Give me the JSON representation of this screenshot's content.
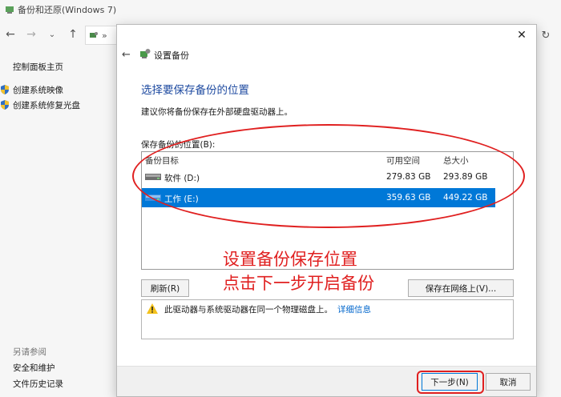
{
  "window": {
    "title": "备份和还原(Windows 7)"
  },
  "sidebar": {
    "home_link": "控制面板主页",
    "tasks": [
      {
        "label": "创建系统映像",
        "icon": "shield-icon"
      },
      {
        "label": "创建系统修复光盘",
        "icon": "shield-icon"
      }
    ],
    "see_also_title": "另请参阅",
    "see_also": [
      {
        "label": "安全和维护"
      },
      {
        "label": "文件历史记录"
      }
    ]
  },
  "address": {
    "partial": "»"
  },
  "dialog": {
    "header_title": "设置备份",
    "heading": "选择要保存备份的位置",
    "description": "建议你将备份保存在外部硬盘驱动器上。",
    "location_label": "保存备份的位置(B):",
    "columns": [
      "备份目标",
      "可用空间",
      "总大小"
    ],
    "drives": [
      {
        "name": "软件 (D:)",
        "free": "279.83 GB",
        "total": "293.89 GB",
        "selected": false
      },
      {
        "name": "工作 (E:)",
        "free": "359.63 GB",
        "total": "449.22 GB",
        "selected": true
      }
    ],
    "refresh_button": "刷新(R)",
    "network_button": "保存在网络上(V)...",
    "warning_text": "此驱动器与系统驱动器在同一个物理磁盘上。",
    "warning_link": "详细信息",
    "next_button": "下一步(N)",
    "cancel_button": "取消"
  },
  "annotation": {
    "line1": "设置备份保存位置",
    "line2": "点击下一步开启备份"
  },
  "colors": {
    "selection": "#0078d7",
    "heading": "#1e4aa0",
    "annotation": "#e02020",
    "link": "#0066cc"
  }
}
